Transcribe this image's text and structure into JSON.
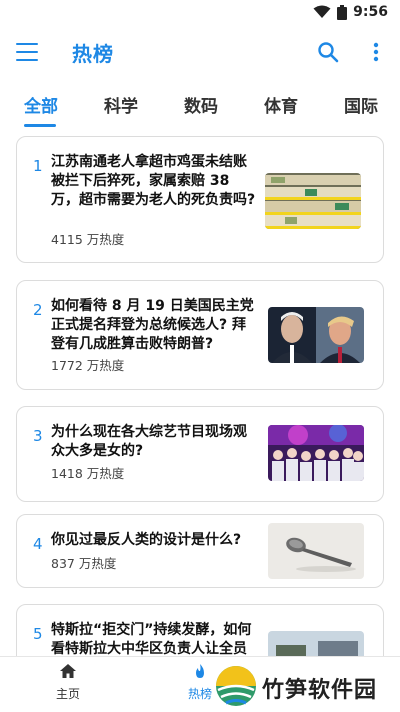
{
  "status_bar": {
    "time": "9:56",
    "icons": [
      "wifi-icon",
      "battery-icon"
    ]
  },
  "app_bar": {
    "title": "热榜",
    "icons": [
      "menu-icon",
      "search-icon",
      "more-vert-icon"
    ]
  },
  "tabs": [
    {
      "label": "全部",
      "active": true
    },
    {
      "label": "科学",
      "active": false
    },
    {
      "label": "数码",
      "active": false
    },
    {
      "label": "体育",
      "active": false
    },
    {
      "label": "国际",
      "active": false
    }
  ],
  "items": [
    {
      "rank": "1",
      "title": "江苏南通老人拿超市鸡蛋未结账被拦下后猝死，家属索赔 38 万，超市需要为老人的死负责吗?",
      "heat": "4115 万热度",
      "image": "eggs-shelf-photo"
    },
    {
      "rank": "2",
      "title": "如何看待 8 月 19 日美国民主党正式提名拜登为总统候选人? 拜登有几成胜算击败特朗普?",
      "heat": "1772 万热度",
      "image": "two-politicians-photo"
    },
    {
      "rank": "3",
      "title": "为什么现在各大综艺节目现场观众大多是女的?",
      "heat": "1418 万热度",
      "image": "concert-audience-photo"
    },
    {
      "rank": "4",
      "title": "你见过最反人类的设计是什么?",
      "heat": "837 万热度",
      "image": "spoon-photo"
    },
    {
      "rank": "5",
      "title": "特斯拉“拒交门”持续发酵，如何看特斯拉大中华区负责人让全员",
      "heat": "",
      "image": "street-photo"
    }
  ],
  "bottom_nav": [
    {
      "label": "主页",
      "icon": "home-icon",
      "active": false
    },
    {
      "label": "热榜",
      "icon": "fire-icon",
      "active": true
    }
  ],
  "watermark": {
    "text": "竹笋软件园",
    "icon": "bamboo-logo-icon"
  },
  "colors": {
    "accent": "#1e88e5",
    "card_border": "#dcdcdc"
  }
}
